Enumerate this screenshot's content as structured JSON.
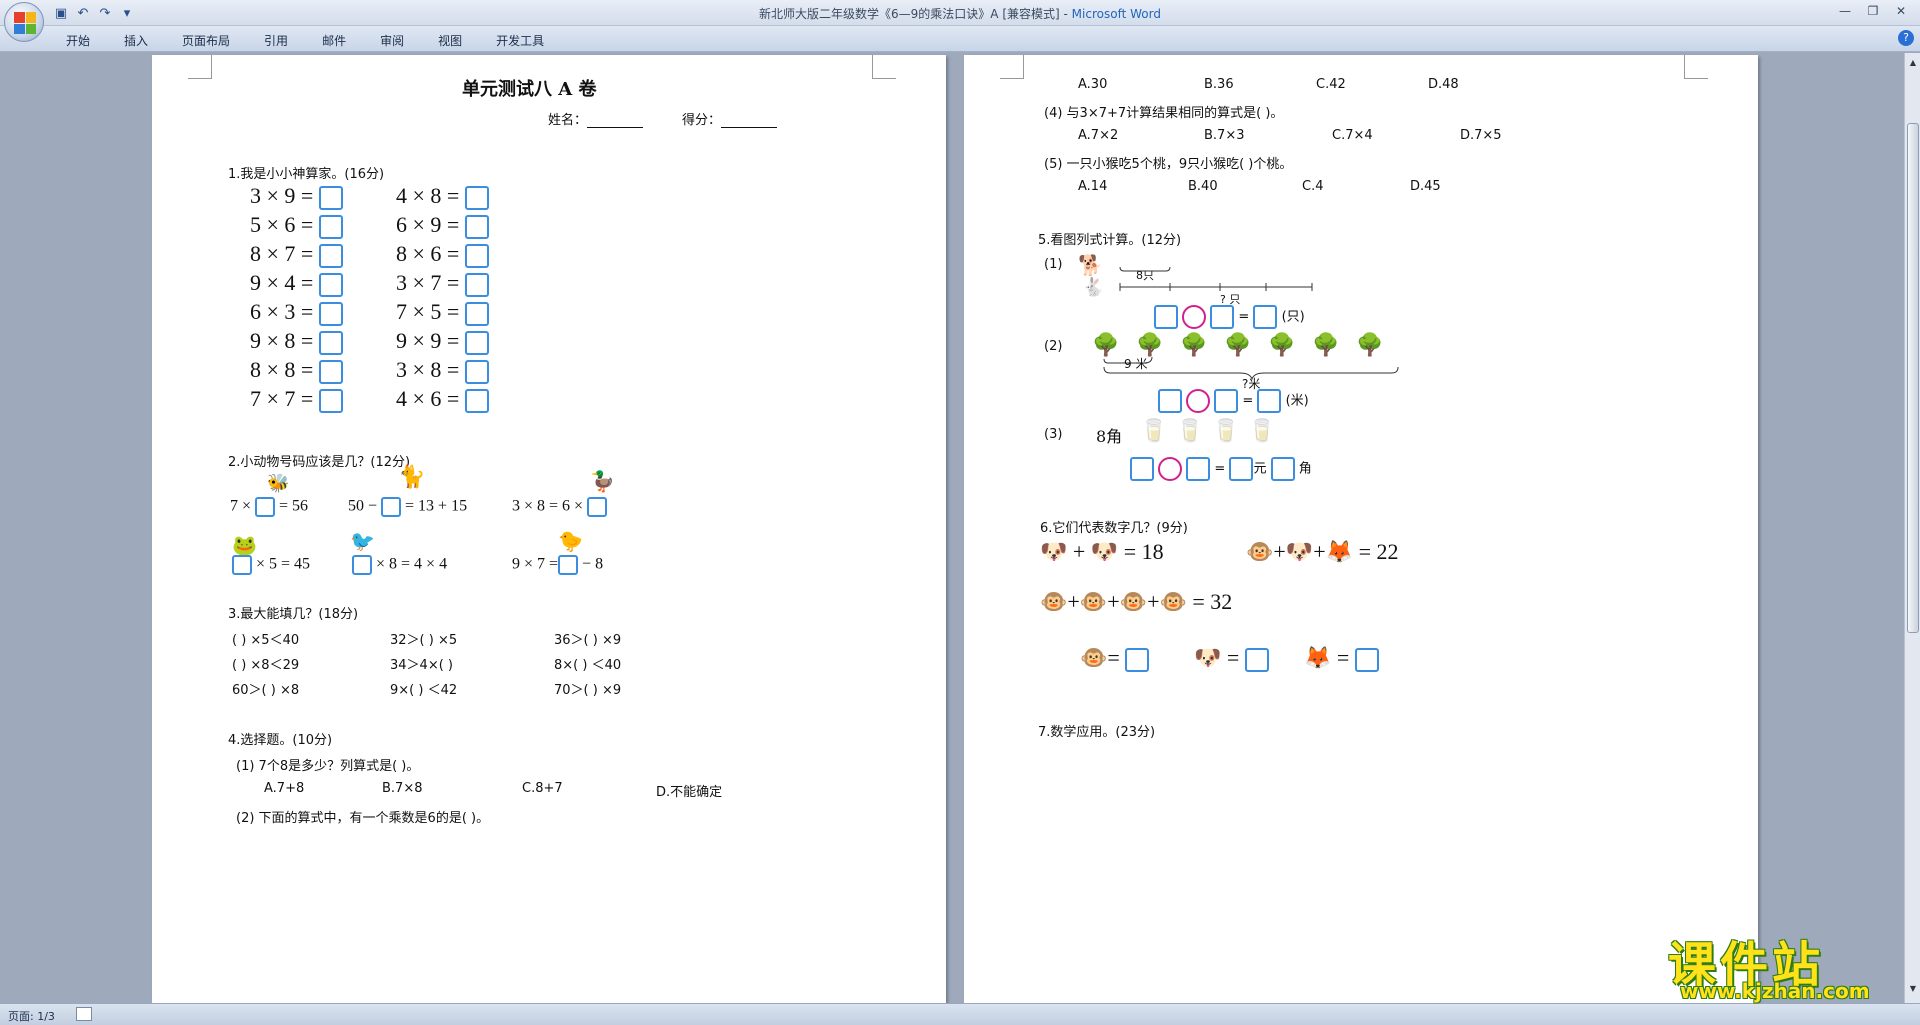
{
  "window": {
    "title": "新北师大版二年级数学《6—9的乘法口诀》A [兼容模式]",
    "app_name": "Microsoft Word",
    "separator": " - "
  },
  "ribbon": {
    "tabs": [
      "开始",
      "插入",
      "页面布局",
      "引用",
      "邮件",
      "审阅",
      "视图",
      "开发工具"
    ]
  },
  "status_bar": {
    "page": "页面: 1/3"
  },
  "page1": {
    "title": "单元测试八  A 卷",
    "name_label": "姓名：",
    "score_label": "得分：",
    "q1_heading": "1.我是小小神算家。(16分)",
    "q1_left": [
      "3 × 9 =",
      "5 × 6 =",
      "8 × 7 =",
      "9 × 4 =",
      "6 × 3 =",
      "9 × 8 =",
      "8 × 8 =",
      "7 × 7 ="
    ],
    "q1_right": [
      "4 × 8 =",
      "6 × 9 =",
      "8 × 6 =",
      "3 × 7 =",
      "7 × 5 =",
      "9 × 9 =",
      "3 × 8 =",
      "4 × 6 ="
    ],
    "q2_heading": "2.小动物号码应该是几？(12分)",
    "q2_row1": [
      {
        "pre": "7 ×",
        "post": "= 56"
      },
      {
        "pre": "50 −",
        "post": "= 13 + 15"
      },
      {
        "pre": "3 × 8 = 6 ×",
        "post": ""
      }
    ],
    "q2_row2": [
      {
        "pre": "",
        "post": "× 5 = 45"
      },
      {
        "pre": "",
        "post": "× 8 = 4 × 4"
      },
      {
        "pre": "9 × 7 =",
        "post": "− 8"
      }
    ],
    "q3_heading": "3.最大能填几？(18分)",
    "q3_rows": [
      [
        "(    ) ×5＜40",
        "32＞(    ) ×5",
        "36＞(    ) ×9"
      ],
      [
        "(    ) ×8＜29",
        "34＞4×(    )",
        "8×(    ) ＜40"
      ],
      [
        "60＞(    ) ×8",
        "9×(    ) ＜42",
        "70＞(    ) ×9"
      ]
    ],
    "q4_heading": "4.选择题。(10分)",
    "q4_1": "(1) 7个8是多少？列算式是(    )。",
    "q4_1_options": [
      "A.7+8",
      "B.7×8",
      "C.8+7",
      "D.不能确定"
    ],
    "q4_2": "(2) 下面的算式中，有一个乘数是6的是(    )。"
  },
  "page2": {
    "q4_3_options": [
      "A.30",
      "B.36",
      "C.42",
      "D.48"
    ],
    "q4_4": "(4) 与3×7+7计算结果相同的算式是(    )。",
    "q4_4_options": [
      "A.7×2",
      "B.7×3",
      "C.7×4",
      "D.7×5"
    ],
    "q4_5": "(5) 一只小猴吃5个桃，9只小猴吃(    )个桃。",
    "q4_5_options": [
      "A.14",
      "B.40",
      "C.4",
      "D.45"
    ],
    "q5_heading": "5.看图列式计算。(12分)",
    "q5_1_label": "(1)",
    "q5_1_top": "8只",
    "q5_1_bottom": "? 只",
    "q5_1_unit": "(只)",
    "q5_2_label": "(2)",
    "q5_2_span": "9 米",
    "q5_2_total": "?米",
    "q5_2_unit": "(米)",
    "q5_3_label": "(3)",
    "q5_3_price": "8角",
    "q5_3_yuan": "元",
    "q5_3_jiao": "角",
    "q6_heading": "6.它们代表数字几？(9分)",
    "q6_eq1": "= 18",
    "q6_eq2": "= 22",
    "q6_eq3": "= 32",
    "q7_heading": "7.数学应用。(23分)"
  },
  "watermark": {
    "cn": "课件站",
    "url": "www.kjzhan.com"
  },
  "colors": {
    "box": "#3b8de0",
    "circle": "#d0208d",
    "watermark": "#ffe21a"
  }
}
